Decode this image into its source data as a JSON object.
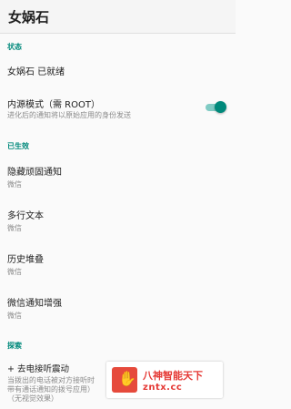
{
  "appbar": {
    "title": "女娲石"
  },
  "sections": {
    "status": {
      "header": "状态",
      "ready": {
        "title": "女娲石 已就绪"
      },
      "inner_mode": {
        "title": "内源模式（需 ROOT）",
        "subtitle": "进化后的通知将以原始应用的身份发送",
        "toggle_on": true
      }
    },
    "effective": {
      "header": "已生效",
      "items": [
        {
          "title": "隐藏顽固通知",
          "subtitle": "微信"
        },
        {
          "title": "多行文本",
          "subtitle": "微信"
        },
        {
          "title": "历史堆叠",
          "subtitle": "微信"
        },
        {
          "title": "微信通知增强",
          "subtitle": "微信"
        }
      ]
    },
    "explore": {
      "header": "探索",
      "item": {
        "title": "+ 去电接听震动",
        "line1": "当拨出的电话被对方接听时",
        "line2": "带有通话通知的拨号应用）",
        "line3": "（无视觉效果）"
      }
    }
  },
  "watermark": {
    "line1": "八神智能天下",
    "line2": "zntx.cc"
  },
  "colors": {
    "accent": "#00897b",
    "toggle_track": "#80cbc4"
  }
}
